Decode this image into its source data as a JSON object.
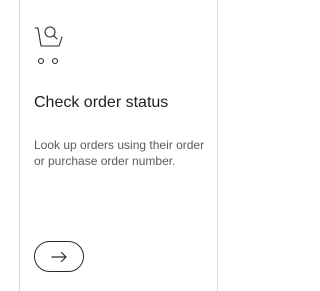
{
  "card": {
    "icon": "shopping-cart-search-icon",
    "title": "Check order status",
    "description": "Look up orders using their order or purchase order number.",
    "action_icon": "arrow-right-icon"
  },
  "colors": {
    "background": "#ffffff",
    "border": "#d9d9d9",
    "title_text": "#1f1f1f",
    "body_text": "#5a5a5a",
    "icon_stroke": "#2b2b2b"
  }
}
